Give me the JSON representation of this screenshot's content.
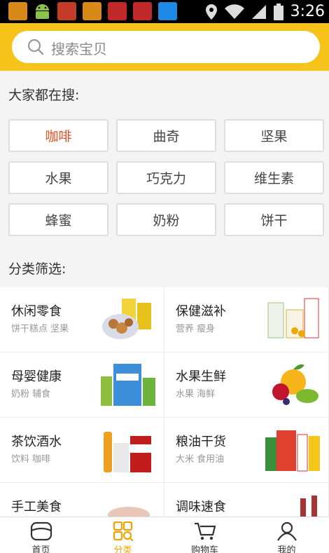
{
  "status_bar": {
    "time": "3:26",
    "notification_icons": [
      "app-icon",
      "android-icon",
      "app-icon",
      "app-icon",
      "app-icon",
      "app-icon",
      "app-icon"
    ]
  },
  "search": {
    "placeholder": "搜索宝贝"
  },
  "hot_search": {
    "title": "大家都在搜:",
    "tags": [
      "咖啡",
      "曲奇",
      "坚果",
      "水果",
      "巧克力",
      "维生素",
      "蜂蜜",
      "奶粉",
      "饼干"
    ],
    "active_index": 0
  },
  "categories": {
    "title": "分类筛选:",
    "items": [
      {
        "title": "休闲零食",
        "sub": "饼干糕点 坚果"
      },
      {
        "title": "保健滋补",
        "sub": "营养 瘦身"
      },
      {
        "title": "母婴健康",
        "sub": "奶粉 辅食"
      },
      {
        "title": "水果生鲜",
        "sub": "水果 海鲜"
      },
      {
        "title": "茶饮酒水",
        "sub": "饮料 咖啡"
      },
      {
        "title": "粮油干货",
        "sub": "大米 食用油"
      },
      {
        "title": "手工美食",
        "sub": ""
      },
      {
        "title": "调味速食",
        "sub": ""
      }
    ]
  },
  "bottom_nav": {
    "items": [
      {
        "label": "首页"
      },
      {
        "label": "分类"
      },
      {
        "label": "购物车"
      },
      {
        "label": "我的"
      }
    ],
    "active_index": 1
  },
  "colors": {
    "accent": "#f6c31a",
    "active_tag": "#e8501d",
    "active_nav": "#f0a300"
  }
}
